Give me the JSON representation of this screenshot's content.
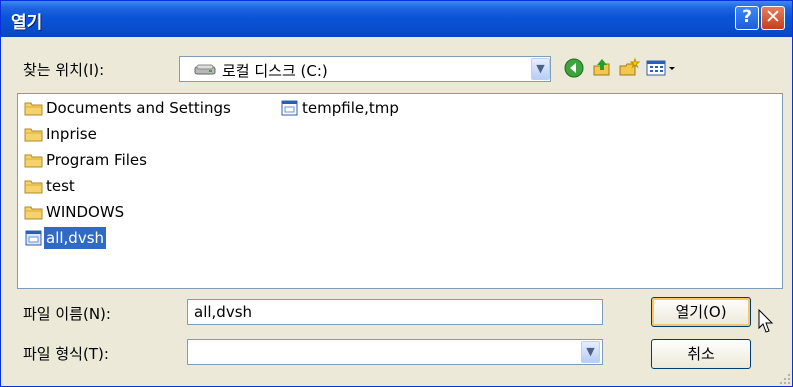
{
  "window": {
    "title": "열기"
  },
  "title_buttons": {
    "help": "?",
    "close": "✕"
  },
  "look_in": {
    "label": "찾는 위치(I):",
    "value": "로컬 디스크 (C:)"
  },
  "toolbar": {
    "icons": [
      "back-icon",
      "up-folder-icon",
      "new-folder-icon",
      "view-menu-icon"
    ]
  },
  "files": [
    {
      "name": "Documents and Settings",
      "type": "folder",
      "selected": false
    },
    {
      "name": "Inprise",
      "type": "folder",
      "selected": false
    },
    {
      "name": "Program Files",
      "type": "folder",
      "selected": false
    },
    {
      "name": "test",
      "type": "folder",
      "selected": false
    },
    {
      "name": "WINDOWS",
      "type": "folder",
      "selected": false
    },
    {
      "name": "all,dvsh",
      "type": "file",
      "selected": true
    },
    {
      "name": "tempfile,tmp",
      "type": "file",
      "selected": false
    }
  ],
  "filename": {
    "label": "파일 이름(N):",
    "value": "all,dvsh"
  },
  "filetype": {
    "label": "파일 형식(T):",
    "value": ""
  },
  "buttons": {
    "open": "열기(O)",
    "cancel": "취소"
  }
}
